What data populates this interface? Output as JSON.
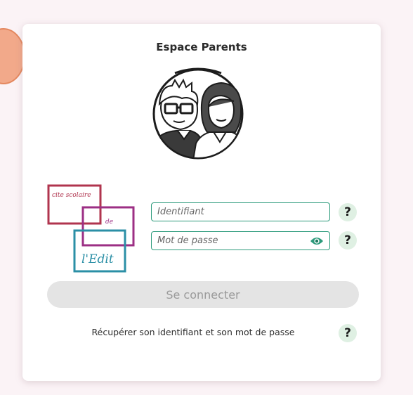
{
  "header": {
    "title": "Espace Parents"
  },
  "logo": {
    "line1": "cite scolaire",
    "line2": "de",
    "line3": "l'Edit"
  },
  "login": {
    "identifiant_placeholder": "Identifiant",
    "password_placeholder": "Mot de passe",
    "help_label": "?",
    "connect_label": "Se connecter",
    "recover_label": "Récupérer son identifiant et son mot de passe"
  },
  "colors": {
    "accent": "#2c9a7b",
    "help_bg": "#dff0e3",
    "button_disabled": "#e4e4e4",
    "logo_red": "#b0344e",
    "logo_purple": "#9c2f84",
    "logo_teal": "#2b8fa6"
  },
  "icons": [
    "parents-avatar-icon",
    "eye-icon",
    "help-icon"
  ]
}
